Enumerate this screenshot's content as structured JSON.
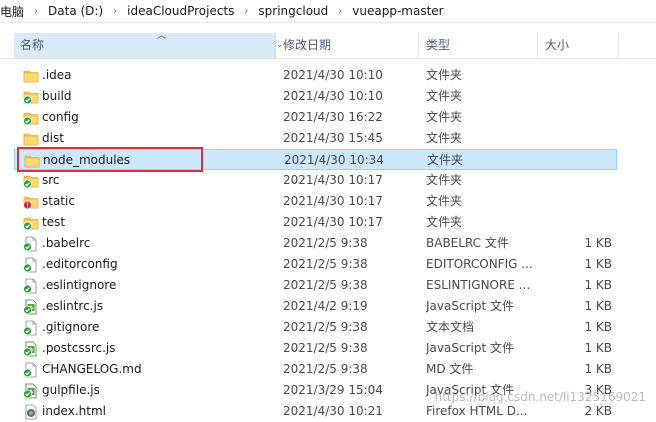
{
  "breadcrumb": [
    "电脑",
    "Data (D:)",
    "ideaCloudProjects",
    "springcloud",
    "vueapp-master"
  ],
  "header": {
    "name": "名称",
    "date": "修改日期",
    "type": "类型",
    "size": "大小"
  },
  "files": [
    {
      "name": ".idea",
      "date": "2021/4/30 10:10",
      "type": "文件夹",
      "size": "",
      "icon": "folder-icon"
    },
    {
      "name": "build",
      "date": "2021/4/30 10:10",
      "type": "文件夹",
      "size": "",
      "icon": "folder-sync-ok-icon"
    },
    {
      "name": "config",
      "date": "2021/4/30 16:22",
      "type": "文件夹",
      "size": "",
      "icon": "folder-sync-ok-icon"
    },
    {
      "name": "dist",
      "date": "2021/4/30 15:45",
      "type": "文件夹",
      "size": "",
      "icon": "folder-icon"
    },
    {
      "name": "node_modules",
      "date": "2021/4/30 10:34",
      "type": "文件夹",
      "size": "",
      "icon": "folder-icon",
      "selected": true
    },
    {
      "name": "src",
      "date": "2021/4/30 10:17",
      "type": "文件夹",
      "size": "",
      "icon": "folder-sync-ok-icon"
    },
    {
      "name": "static",
      "date": "2021/4/30 10:17",
      "type": "文件夹",
      "size": "",
      "icon": "folder-conflict-icon"
    },
    {
      "name": "test",
      "date": "2021/4/30 10:17",
      "type": "文件夹",
      "size": "",
      "icon": "folder-sync-ok-icon"
    },
    {
      "name": ".babelrc",
      "date": "2021/2/5 9:38",
      "type": "BABELRC 文件",
      "size": "1 KB",
      "icon": "file-sync-ok-icon"
    },
    {
      "name": ".editorconfig",
      "date": "2021/2/5 9:38",
      "type": "EDITORCONFIG ...",
      "size": "1 KB",
      "icon": "file-sync-ok-icon"
    },
    {
      "name": ".eslintignore",
      "date": "2021/2/5 9:38",
      "type": "ESLINTIGNORE ...",
      "size": "1 KB",
      "icon": "file-sync-ok-icon"
    },
    {
      "name": ".eslintrc.js",
      "date": "2021/4/2 9:19",
      "type": "JavaScript 文件",
      "size": "1 KB",
      "icon": "js-file-sync-ok-icon"
    },
    {
      "name": ".gitignore",
      "date": "2021/2/5 9:38",
      "type": "文本文档",
      "size": "1 KB",
      "icon": "file-sync-ok-icon"
    },
    {
      "name": ".postcssrc.js",
      "date": "2021/2/5 9:38",
      "type": "JavaScript 文件",
      "size": "1 KB",
      "icon": "js-file-sync-ok-icon"
    },
    {
      "name": "CHANGELOG.md",
      "date": "2021/2/5 9:38",
      "type": "MD 文件",
      "size": "1 KB",
      "icon": "file-sync-ok-icon"
    },
    {
      "name": "gulpfile.js",
      "date": "2021/3/29 15:04",
      "type": "JavaScript 文件",
      "size": "3 KB",
      "icon": "js-file-sync-ok-icon"
    },
    {
      "name": "index.html",
      "date": "2021/4/30 10:21",
      "type": "Firefox HTML D...",
      "size": "2 KB",
      "icon": "html-file-icon"
    }
  ],
  "watermark": "https://blog.csdn.net/li1325169021"
}
